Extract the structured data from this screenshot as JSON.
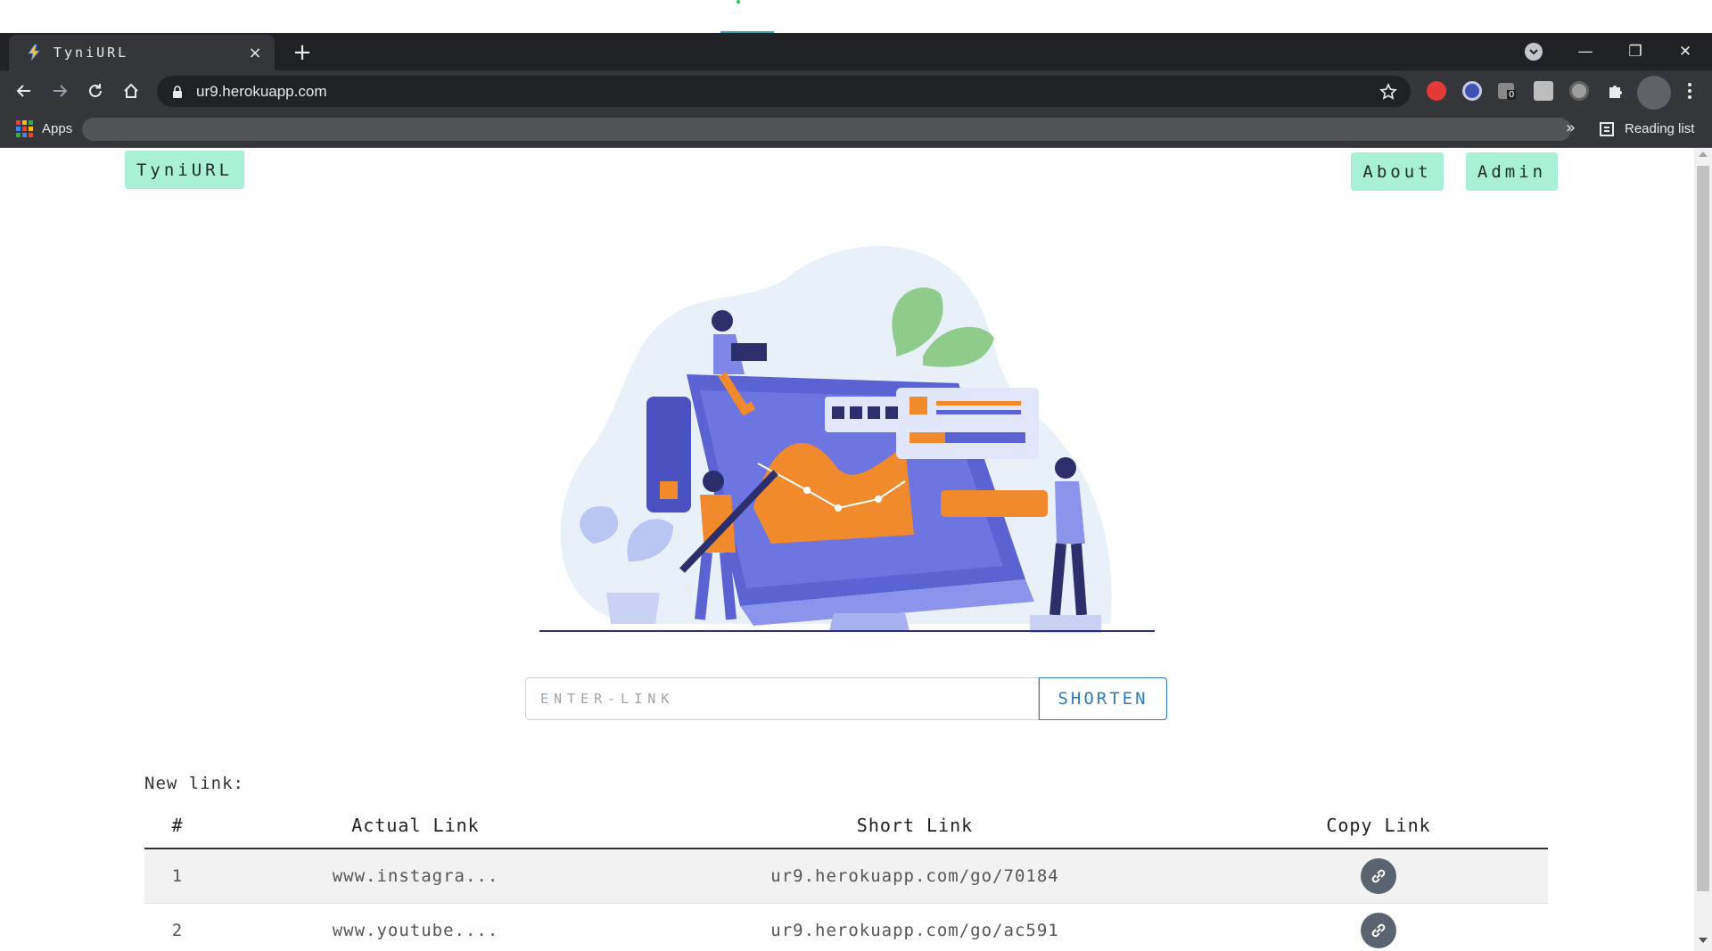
{
  "browser": {
    "tab_title": "TyniURL",
    "tab_close": "×",
    "new_tab": "+",
    "url": "ur9.herokuapp.com",
    "apps_label": "Apps",
    "bookmarks_overflow": "»",
    "reading_list": "Reading list",
    "extension_badge": "0",
    "win_minimize": "—",
    "win_restore": "❐",
    "win_close": "✕"
  },
  "nav": {
    "brand": "TyniURL",
    "about": "About",
    "admin": "Admin"
  },
  "form": {
    "placeholder": "ENTER-LINK",
    "value": "",
    "submit": "SHORTEN"
  },
  "results": {
    "label": "New link:",
    "headers": [
      "#",
      "Actual Link",
      "Short Link",
      "Copy Link"
    ],
    "rows": [
      {
        "n": "1",
        "actual": "www.instagra...",
        "short": "ur9.herokuapp.com/go/70184"
      },
      {
        "n": "2",
        "actual": "www.youtube....",
        "short": "ur9.herokuapp.com/go/ac591"
      }
    ]
  },
  "colors": {
    "accent_mint": "#a8f0d6",
    "button_blue": "#2a7cc2",
    "illustration_blue": "#5b63d3",
    "illustration_orange": "#f08a2c",
    "blob": "#e8f0fa"
  }
}
